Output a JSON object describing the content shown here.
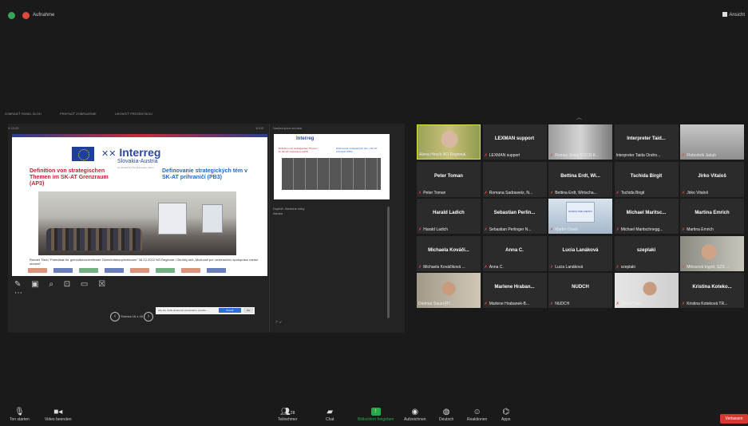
{
  "topbar": {
    "recording_label": "Aufnahme",
    "view_label": "Ansicht"
  },
  "share": {
    "toolbar_items": [
      "ZOBRAZIŤ PANEL ÚLOH",
      "PREPNÚŤ ZOBRAZENIE",
      "UKONČIŤ PREZENTÁCIU"
    ],
    "timer": "0:13:20",
    "clock": "10:03",
    "slide": {
      "interreg": "Interreg",
      "program": "Slovakia-Austria",
      "cofunded": "Co-funded by the European Union",
      "title_de": "Definition von strategischen Themen im SK-AT Grenzraum (AP3)",
      "title_sk": "Definovanie strategických tém v SK-AT prihraničí (PB3)",
      "caption": "Runder Tisch \"Potentiale für grenzüberschreitende Gemeindekooperationen\" 06.12.2022 NÖ.Regional / Okrúhly stôl „Možnosti pre cezhraničnú spoluprácu medzi obcami\""
    },
    "tools": "✎ ▣ ⌕ ⊡ ▭ ☒ ⋯",
    "slide_counter": "Snímka 16 z 45",
    "notification": {
      "text": "Aby ste mohli spravovať prezentáciu, povoľte...",
      "primary": "Povoliť",
      "secondary": "Nie"
    },
    "next_slide_label": "Nasledujúca snímka",
    "next_thumb_title": "Interreg",
    "next_thumb_red": "Definition von strategischen Themen im SK-AT Grenzraum (AP3)",
    "next_thumb_blue": "Definovanie strategických tém v SK-AT prihraničí (PB3)",
    "notes": [
      "Doplniť: Aleksine fotky",
      "Alenka"
    ],
    "zoom_controls": "↗ ↙"
  },
  "gallery": {
    "tiles": [
      {
        "big": "",
        "name": "Alena Hirsch NÖ.Regional",
        "video": "f1",
        "active": true,
        "muted": false
      },
      {
        "big": "LEXMAN support",
        "name": "LEXMAN support",
        "video": "",
        "active": false,
        "muted": true
      },
      {
        "big": "",
        "name": "Roman Jirsky KOCR K...",
        "video": "f2",
        "active": false,
        "muted": true
      },
      {
        "big": "Interpreter Taid...",
        "name": "Interpreter Taida Ondro...",
        "video": "",
        "active": false,
        "muted": false
      },
      {
        "big": "",
        "name": "Flobodník Jakub",
        "video": "f3",
        "active": false,
        "muted": true
      },
      {
        "big": "Peter Toman",
        "name": "Peter Toman",
        "video": "",
        "active": false,
        "muted": true
      },
      {
        "big": "",
        "name": "Romana Sadrawetz, N...",
        "video": "",
        "active": false,
        "muted": true
      },
      {
        "big": "Bettina Erdt, Wi...",
        "name": "Bettina Erdt, Wirtscha...",
        "video": "",
        "active": false,
        "muted": true
      },
      {
        "big": "Tschida Birgit",
        "name": "Tschida Birgit",
        "video": "",
        "active": false,
        "muted": true
      },
      {
        "big": "Jirko Vitaloš",
        "name": "Jirko Vitaloš",
        "video": "",
        "active": false,
        "muted": true
      },
      {
        "big": "Harald Ladich",
        "name": "Harald Ladich",
        "video": "",
        "active": false,
        "muted": true
      },
      {
        "big": "Sebastian Perlin...",
        "name": "Sebastian Perlinger N...",
        "video": "",
        "active": false,
        "muted": true
      },
      {
        "big": "",
        "name": "Martin Orsek",
        "video": "f5",
        "active": false,
        "muted": true,
        "logo": "DOMOV PRE MESTO"
      },
      {
        "big": "Michael Maritsc...",
        "name": "Michael Maritschnegg...",
        "video": "",
        "active": false,
        "muted": true
      },
      {
        "big": "Martina Emrich",
        "name": "Martina Emrich",
        "video": "",
        "active": false,
        "muted": true
      },
      {
        "big": "Michaela Kováči...",
        "name": "Michaela Kováčiková ...",
        "video": "",
        "active": false,
        "muted": true
      },
      {
        "big": "Anna C.",
        "name": "Anna C.",
        "video": "",
        "active": false,
        "muted": true
      },
      {
        "big": "Lucia Lanáková",
        "name": "Lucia Lanáková",
        "video": "",
        "active": false,
        "muted": true
      },
      {
        "big": "szeplaki",
        "name": "szeplaki",
        "video": "",
        "active": false,
        "muted": true
      },
      {
        "big": "",
        "name": "Mikosová Ingrid, SZS ...",
        "video": "f6",
        "active": false,
        "muted": true
      },
      {
        "big": "",
        "name": "Dietmar Sauer(RT...",
        "video": "f7",
        "active": false,
        "muted": false
      },
      {
        "big": "Marlene Hraban...",
        "name": "Marlene Hrabanek-B...",
        "video": "",
        "active": false,
        "muted": true
      },
      {
        "big": "NUDCH",
        "name": "NUDCH",
        "video": "",
        "active": false,
        "muted": true
      },
      {
        "big": "",
        "name": "Martin Hara",
        "video": "f8",
        "active": false,
        "muted": true
      },
      {
        "big": "Kristina Koteko...",
        "name": "Kristina Koteková TR...",
        "video": "",
        "active": false,
        "muted": true
      }
    ]
  },
  "toolbar": {
    "audio": "Ton starten",
    "video": "Video beenden",
    "participants": "Teilnehmer",
    "participants_count": "28",
    "chat": "Chat",
    "share": "Bildschirm freigeben",
    "record": "Aufzeichnen",
    "translate": "Deutsch",
    "reactions": "Reaktionen",
    "apps": "Apps",
    "leave": "Verlassen"
  },
  "colors": {
    "accent_green": "#2aa84a",
    "leave_red": "#d43a32",
    "active_speaker": "#d7e53a",
    "interreg_blue": "#2b4aa3"
  }
}
